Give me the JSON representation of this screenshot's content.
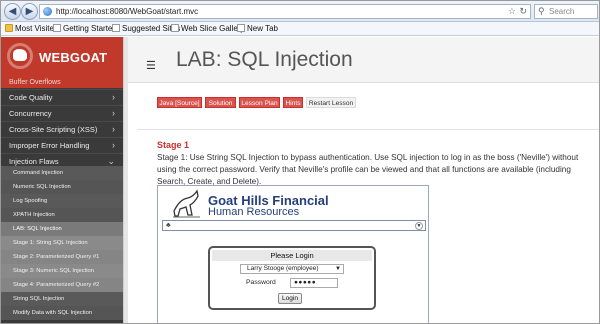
{
  "browser": {
    "url": "http://localhost:8080/WebGoat/start.mvc",
    "search_placeholder": "Search",
    "bookmarks": [
      "Most Visited",
      "Getting Started",
      "Suggested Sites",
      "Web Slice Gallery",
      "New Tab"
    ]
  },
  "sidebar": {
    "logo": "WEBGOAT",
    "cut_item": "Buffer Overflows",
    "categories": [
      "Code Quality",
      "Concurrency",
      "Cross-Site Scripting (XSS)",
      "Improper Error Handling",
      "Injection Flaws"
    ],
    "subitems": [
      "Command Injection",
      "Numeric SQL Injection",
      "Log Spoofing",
      "XPATH Injection",
      "LAB: SQL Injection",
      "Stage 1: String SQL Injection",
      "Stage 2: Parameterized Query #1",
      "Stage 3: Numeric SQL Injection",
      "Stage 4: Parameterized Query #2",
      "String SQL Injection",
      "Modify Data with SQL Injection"
    ]
  },
  "header": {
    "title": "LAB: SQL Injection"
  },
  "lesson_buttons": [
    "Java [Source]",
    "Solution",
    "Lesson Plan",
    "Hints",
    "Restart Lesson"
  ],
  "stage": {
    "heading": "Stage 1",
    "text": "Stage 1: Use String SQL Injection to bypass authentication. Use SQL injection to log in as the boss ('Neville') without using the correct password. Verify that Neville's profile can be viewed and that all functions are available (including Search, Create, and Delete)."
  },
  "app": {
    "company": "Goat Hills Financial",
    "department": "Human Resources",
    "login_title": "Please Login",
    "user_selected": "Larry Stooge (employee)",
    "password_label": "Password",
    "password_value": "●●●●●",
    "login_button": "Login"
  },
  "colors": {
    "brand_red": "#c0392b",
    "sidebar_bg": "#3a3a3a",
    "button_red": "#d9534f",
    "stage_red": "#c9302c"
  }
}
